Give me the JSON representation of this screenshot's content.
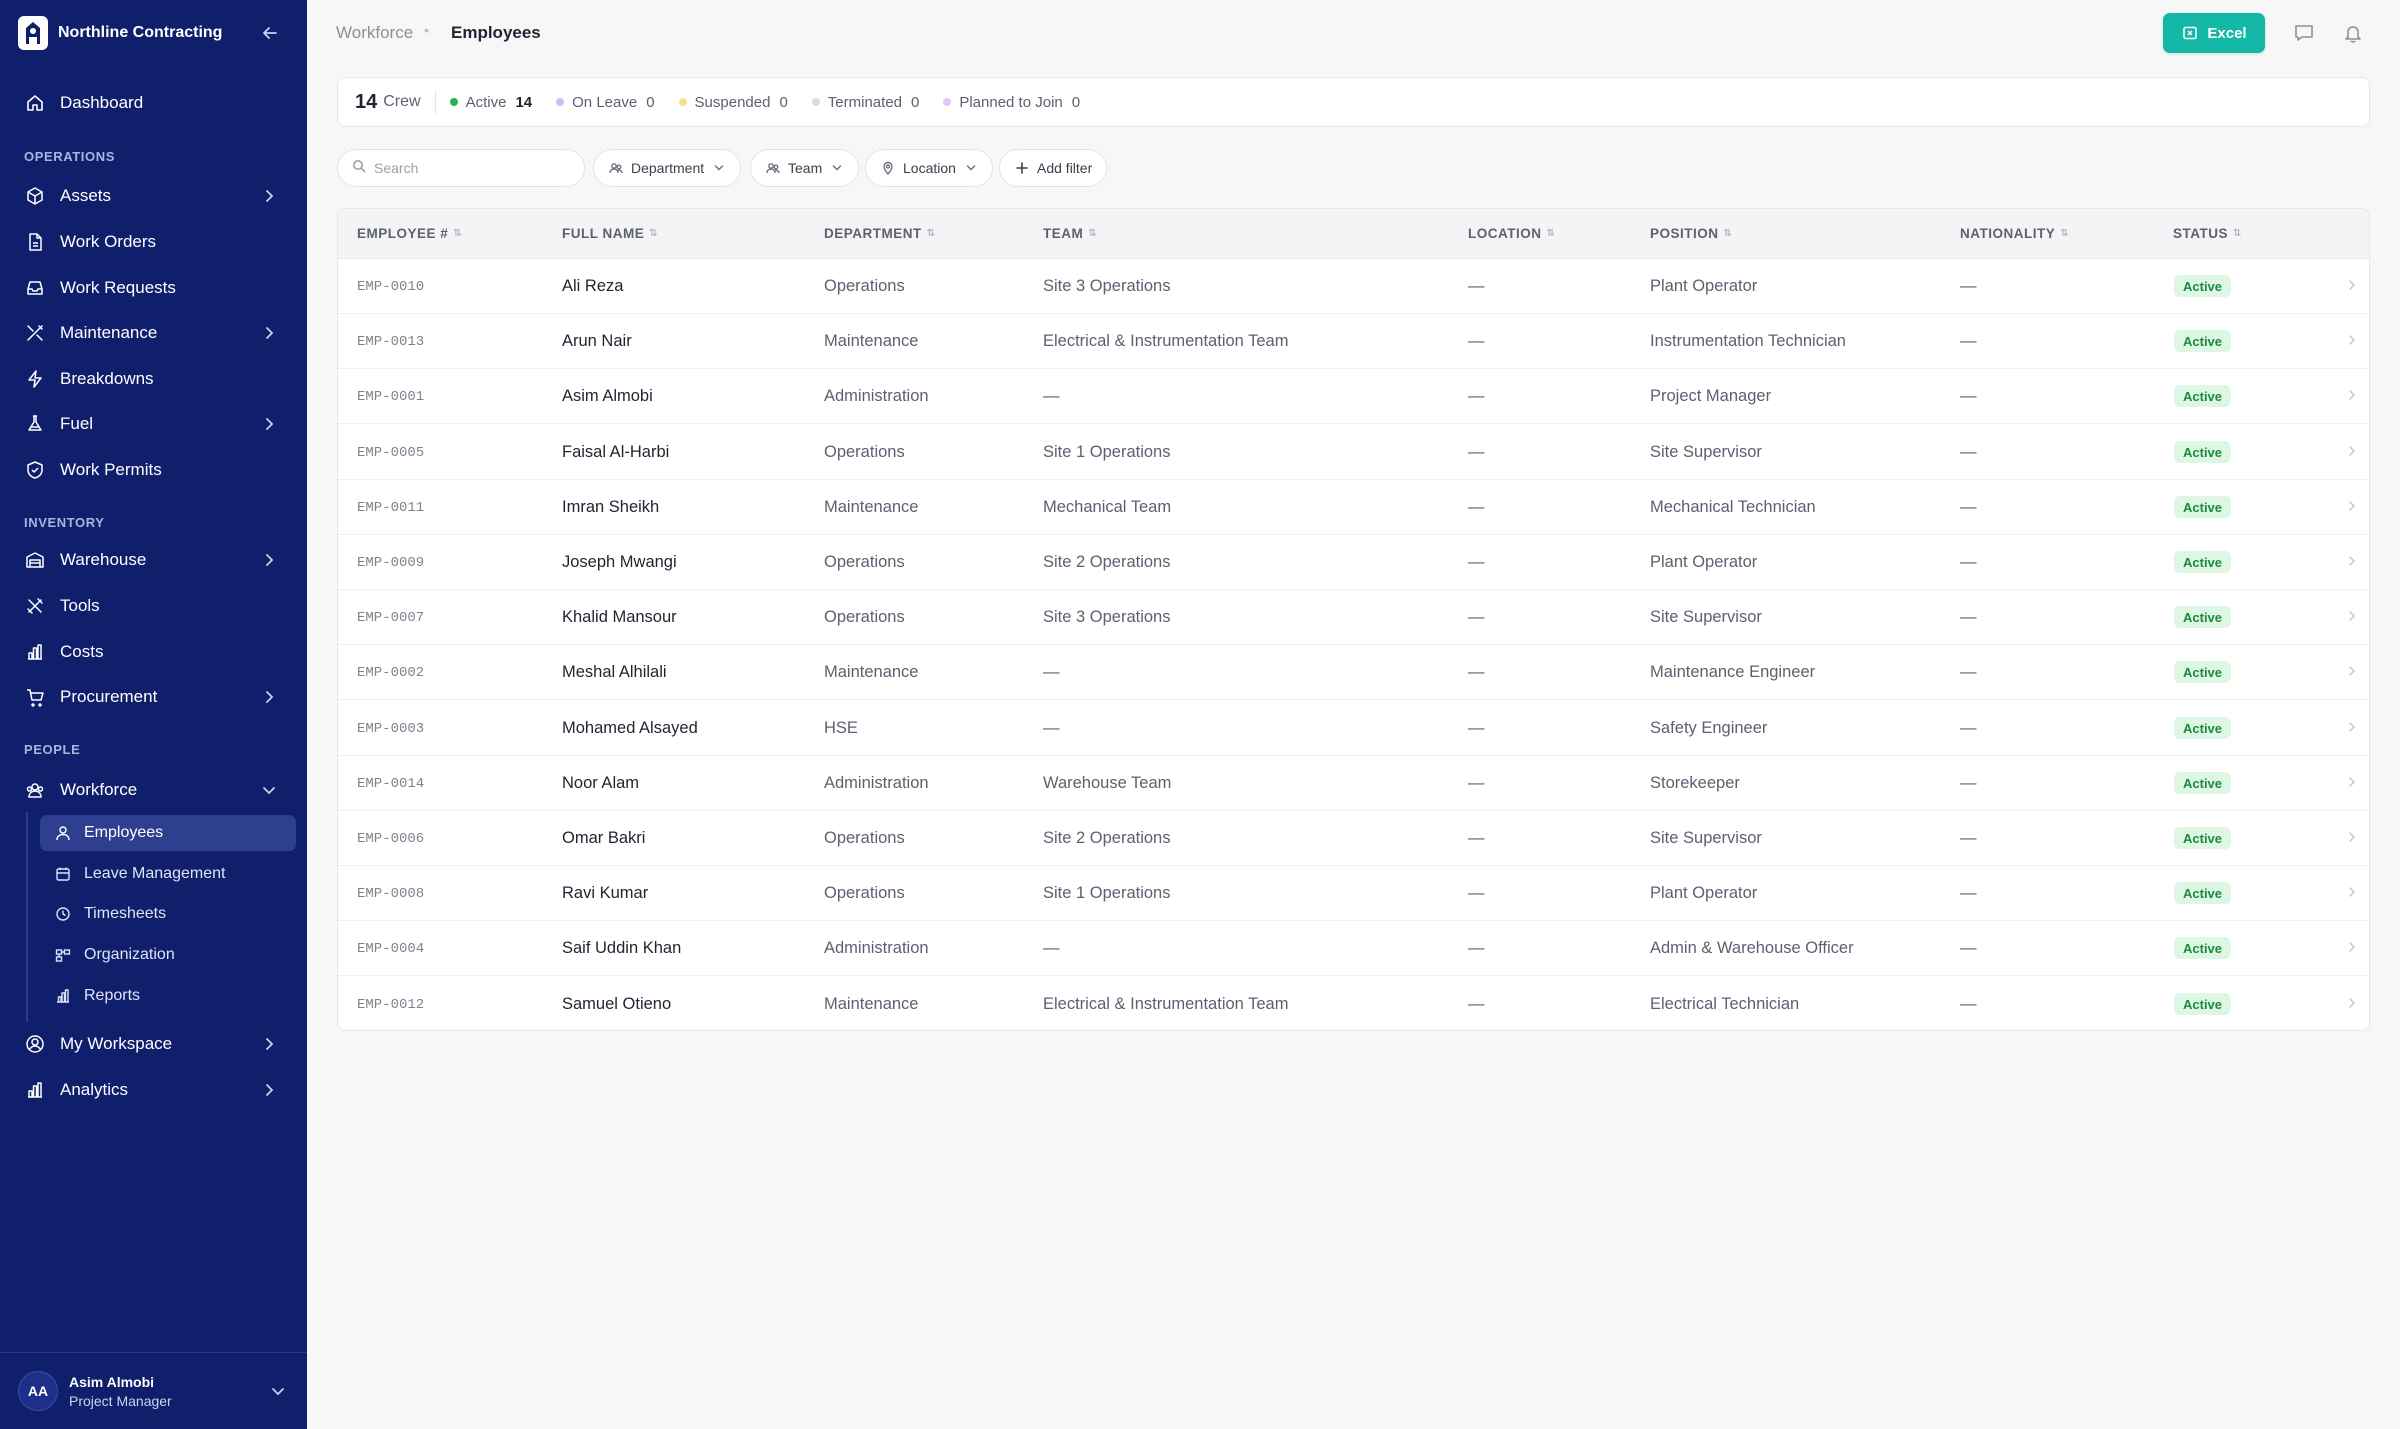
{
  "brand": {
    "name": "Northline Contracting"
  },
  "sidebar": {
    "dashboard": "Dashboard",
    "sections": {
      "operations": "OPERATIONS",
      "inventory": "INVENTORY",
      "people": "PEOPLE"
    },
    "operations": [
      {
        "label": "Assets",
        "icon": "cube-icon"
      },
      {
        "label": "Work Orders",
        "icon": "document-icon"
      },
      {
        "label": "Work Requests",
        "icon": "inbox-icon"
      },
      {
        "label": "Maintenance",
        "icon": "tools-icon"
      },
      {
        "label": "Breakdowns",
        "icon": "bolt-icon"
      },
      {
        "label": "Fuel",
        "icon": "flask-icon"
      },
      {
        "label": "Work Permits",
        "icon": "shield-icon"
      }
    ],
    "inventory": [
      {
        "label": "Warehouse",
        "icon": "warehouse-icon"
      },
      {
        "label": "Tools",
        "icon": "wrench-icon"
      },
      {
        "label": "Costs",
        "icon": "bar-chart-icon"
      },
      {
        "label": "Procurement",
        "icon": "cart-icon"
      }
    ],
    "workforce": {
      "label": "Workforce",
      "items": [
        {
          "label": "Employees",
          "icon": "user-icon"
        },
        {
          "label": "Leave Management",
          "icon": "calendar-icon"
        },
        {
          "label": "Timesheets",
          "icon": "clock-icon"
        },
        {
          "label": "Organization",
          "icon": "org-chart-icon"
        },
        {
          "label": "Reports",
          "icon": "report-icon"
        }
      ]
    },
    "my_workspace": "My Workspace",
    "analytics": "Analytics",
    "user": {
      "initials": "AA",
      "name": "Asim Almobi",
      "role": "Project Manager"
    }
  },
  "header": {
    "breadcrumb": [
      "Workforce",
      "Employees"
    ],
    "separator": "•",
    "excel_label": "Excel"
  },
  "summary": {
    "crew_count": "14",
    "crew_label": "Crew",
    "stats": [
      {
        "label": "Active",
        "count": "14",
        "color": "#22b455"
      },
      {
        "label": "On Leave",
        "count": "0",
        "color": "#b9c6f5"
      },
      {
        "label": "Suspended",
        "count": "0",
        "color": "#f7e08a"
      },
      {
        "label": "Terminated",
        "count": "0",
        "color": "#d9dbe0"
      },
      {
        "label": "Planned to Join",
        "count": "0",
        "color": "#e3c6f2"
      }
    ]
  },
  "filters": {
    "search_placeholder": "Search",
    "department": "Department",
    "team": "Team",
    "location": "Location",
    "add_filter": "Add filter"
  },
  "table": {
    "columns": [
      "EMPLOYEE #",
      "FULL NAME",
      "DEPARTMENT",
      "TEAM",
      "LOCATION",
      "POSITION",
      "NATIONALITY",
      "STATUS"
    ],
    "rows": [
      {
        "id": "EMP-0010",
        "name": "Ali Reza",
        "department": "Operations",
        "team": "Site 3 Operations",
        "location": "—",
        "position": "Plant Operator",
        "nationality": "—",
        "status": "Active"
      },
      {
        "id": "EMP-0013",
        "name": "Arun Nair",
        "department": "Maintenance",
        "team": "Electrical & Instrumentation Team",
        "location": "—",
        "position": "Instrumentation Technician",
        "nationality": "—",
        "status": "Active"
      },
      {
        "id": "EMP-0001",
        "name": "Asim Almobi",
        "department": "Administration",
        "team": "—",
        "location": "—",
        "position": "Project Manager",
        "nationality": "—",
        "status": "Active"
      },
      {
        "id": "EMP-0005",
        "name": "Faisal Al-Harbi",
        "department": "Operations",
        "team": "Site 1 Operations",
        "location": "—",
        "position": "Site Supervisor",
        "nationality": "—",
        "status": "Active"
      },
      {
        "id": "EMP-0011",
        "name": "Imran Sheikh",
        "department": "Maintenance",
        "team": "Mechanical Team",
        "location": "—",
        "position": "Mechanical Technician",
        "nationality": "—",
        "status": "Active"
      },
      {
        "id": "EMP-0009",
        "name": "Joseph Mwangi",
        "department": "Operations",
        "team": "Site 2 Operations",
        "location": "—",
        "position": "Plant Operator",
        "nationality": "—",
        "status": "Active"
      },
      {
        "id": "EMP-0007",
        "name": "Khalid Mansour",
        "department": "Operations",
        "team": "Site 3 Operations",
        "location": "—",
        "position": "Site Supervisor",
        "nationality": "—",
        "status": "Active"
      },
      {
        "id": "EMP-0002",
        "name": "Meshal Alhilali",
        "department": "Maintenance",
        "team": "—",
        "location": "—",
        "position": "Maintenance Engineer",
        "nationality": "—",
        "status": "Active"
      },
      {
        "id": "EMP-0003",
        "name": "Mohamed Alsayed",
        "department": "HSE",
        "team": "—",
        "location": "—",
        "position": "Safety Engineer",
        "nationality": "—",
        "status": "Active"
      },
      {
        "id": "EMP-0014",
        "name": "Noor Alam",
        "department": "Administration",
        "team": "Warehouse Team",
        "location": "—",
        "position": "Storekeeper",
        "nationality": "—",
        "status": "Active"
      },
      {
        "id": "EMP-0006",
        "name": "Omar Bakri",
        "department": "Operations",
        "team": "Site 2 Operations",
        "location": "—",
        "position": "Site Supervisor",
        "nationality": "—",
        "status": "Active"
      },
      {
        "id": "EMP-0008",
        "name": "Ravi Kumar",
        "department": "Operations",
        "team": "Site 1 Operations",
        "location": "—",
        "position": "Plant Operator",
        "nationality": "—",
        "status": "Active"
      },
      {
        "id": "EMP-0004",
        "name": "Saif Uddin Khan",
        "department": "Administration",
        "team": "—",
        "location": "—",
        "position": "Admin & Warehouse Officer",
        "nationality": "—",
        "status": "Active"
      },
      {
        "id": "EMP-0012",
        "name": "Samuel Otieno",
        "department": "Maintenance",
        "team": "Electrical & Instrumentation Team",
        "location": "—",
        "position": "Electrical Technician",
        "nationality": "—",
        "status": "Active"
      }
    ]
  },
  "colors": {
    "sidebar_bg": "#0f1f6b",
    "accent": "#14b8a6",
    "active_badge": "#def7e4"
  }
}
